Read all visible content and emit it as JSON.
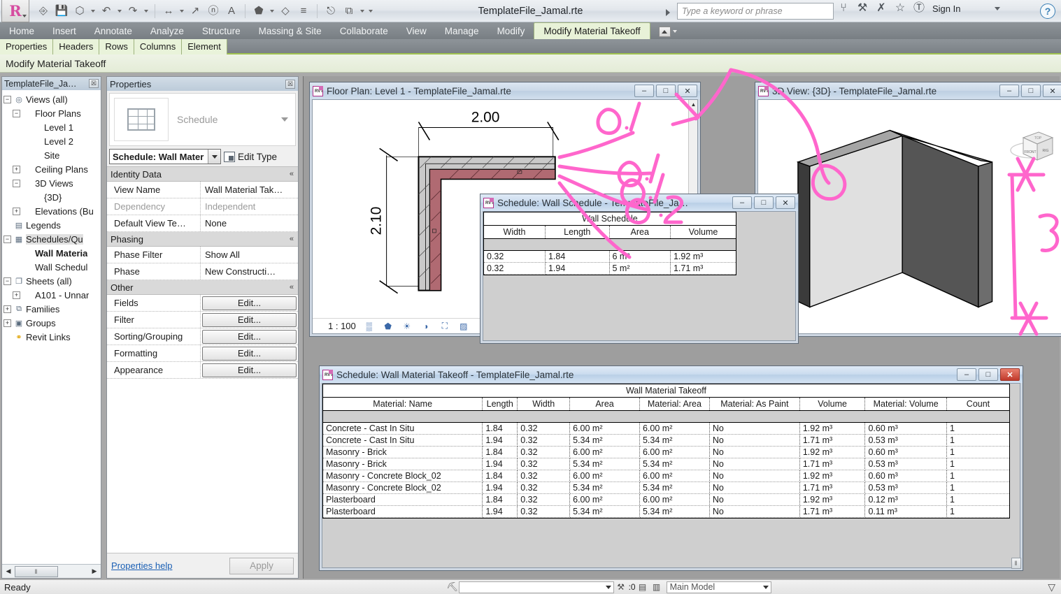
{
  "titlebar": {
    "document_title": "TemplateFile_Jamal.rte",
    "search_placeholder": "Type a keyword or phrase",
    "sign_in": "Sign In",
    "help_glyph": "?",
    "quick_access": [
      {
        "name": "open-icon",
        "glyph": "◱"
      },
      {
        "name": "save-icon",
        "glyph": "ὋE"
      },
      {
        "name": "sync-icon",
        "glyph": "⬡"
      },
      {
        "name": "undo-icon",
        "glyph": "↶"
      },
      {
        "name": "redo-icon",
        "glyph": "↷"
      },
      {
        "name": "measure-icon",
        "glyph": "↔"
      },
      {
        "name": "aligned-dimension-icon",
        "glyph": "↗"
      },
      {
        "name": "tag-icon",
        "glyph": "ⓞ"
      },
      {
        "name": "text-icon",
        "glyph": "A"
      },
      {
        "name": "default-3d-view-icon",
        "glyph": "⬟"
      },
      {
        "name": "section-icon",
        "glyph": "◇"
      },
      {
        "name": "thin-lines-icon",
        "glyph": "≡"
      },
      {
        "name": "close-hidden-windows-icon",
        "glyph": "⎋"
      },
      {
        "name": "switch-windows-icon",
        "glyph": "⧉"
      },
      {
        "name": "customize-qat-icon",
        "glyph": "▾"
      }
    ],
    "right_icons": [
      {
        "name": "infocenter-search-icon",
        "glyph": "⑂"
      },
      {
        "name": "subscription-center-icon",
        "glyph": "⚒"
      },
      {
        "name": "communication-center-icon",
        "glyph": "✇"
      },
      {
        "name": "favorites-icon",
        "glyph": "☆"
      },
      {
        "name": "user-account-icon",
        "glyph": "⛉"
      }
    ]
  },
  "ribbon": {
    "tabs": [
      {
        "label": "Home",
        "active": false
      },
      {
        "label": "Insert",
        "active": false
      },
      {
        "label": "Annotate",
        "active": false
      },
      {
        "label": "Analyze",
        "active": false
      },
      {
        "label": "Structure",
        "active": false
      },
      {
        "label": "Massing & Site",
        "active": false
      },
      {
        "label": "Collaborate",
        "active": false
      },
      {
        "label": "View",
        "active": false
      },
      {
        "label": "Manage",
        "active": false
      },
      {
        "label": "Modify",
        "active": false
      },
      {
        "label": "Modify Material Takeoff",
        "active": true
      }
    ],
    "panel_tabs": [
      "Properties",
      "Headers",
      "Rows",
      "Columns",
      "Element"
    ],
    "contextual_label": "Modify Material Takeoff"
  },
  "browser": {
    "title": "TemplateFile_Ja…",
    "close_glyph": "☒",
    "nodes": [
      {
        "label": "Views (all)",
        "indent": 0,
        "expander": "−",
        "icon": "views-icon",
        "icon_glyph": "◎",
        "bold": false,
        "selected": false
      },
      {
        "label": "Floor Plans",
        "indent": 1,
        "expander": "−",
        "icon": "folder-icon",
        "icon_glyph": "",
        "bold": false,
        "selected": false
      },
      {
        "label": "Level 1",
        "indent": 2,
        "expander": "",
        "icon": "view-icon",
        "icon_glyph": "",
        "bold": false,
        "selected": false
      },
      {
        "label": "Level 2",
        "indent": 2,
        "expander": "",
        "icon": "view-icon",
        "icon_glyph": "",
        "bold": false,
        "selected": false
      },
      {
        "label": "Site",
        "indent": 2,
        "expander": "",
        "icon": "view-icon",
        "icon_glyph": "",
        "bold": false,
        "selected": false
      },
      {
        "label": "Ceiling Plans",
        "indent": 1,
        "expander": "+",
        "icon": "folder-icon",
        "icon_glyph": "",
        "bold": false,
        "selected": false
      },
      {
        "label": "3D Views",
        "indent": 1,
        "expander": "−",
        "icon": "folder-icon",
        "icon_glyph": "",
        "bold": false,
        "selected": false
      },
      {
        "label": "{3D}",
        "indent": 2,
        "expander": "",
        "icon": "view-icon",
        "icon_glyph": "",
        "bold": false,
        "selected": false
      },
      {
        "label": "Elevations (Bu",
        "indent": 1,
        "expander": "+",
        "icon": "folder-icon",
        "icon_glyph": "",
        "bold": false,
        "selected": false
      },
      {
        "label": "Legends",
        "indent": 0,
        "expander": "",
        "icon": "legend-icon",
        "icon_glyph": "▤",
        "bold": false,
        "selected": false
      },
      {
        "label": "Schedules/Qu",
        "indent": 0,
        "expander": "−",
        "icon": "schedule-icon",
        "icon_glyph": "▦",
        "bold": false,
        "selected": true
      },
      {
        "label": "Wall Materia",
        "indent": 1,
        "expander": "",
        "icon": "schedule-view-icon",
        "icon_glyph": "",
        "bold": true,
        "selected": false
      },
      {
        "label": "Wall Schedul",
        "indent": 1,
        "expander": "",
        "icon": "schedule-view-icon",
        "icon_glyph": "",
        "bold": false,
        "selected": false
      },
      {
        "label": "Sheets (all)",
        "indent": 0,
        "expander": "−",
        "icon": "sheets-icon",
        "icon_glyph": "❐",
        "bold": false,
        "selected": false
      },
      {
        "label": "A101 - Unnar",
        "indent": 1,
        "expander": "+",
        "icon": "sheet-icon",
        "icon_glyph": "",
        "bold": false,
        "selected": false
      },
      {
        "label": "Families",
        "indent": 0,
        "expander": "+",
        "icon": "families-icon",
        "icon_glyph": "⧉",
        "bold": false,
        "selected": false
      },
      {
        "label": "Groups",
        "indent": 0,
        "expander": "+",
        "icon": "groups-icon",
        "icon_glyph": "▣",
        "bold": false,
        "selected": false
      },
      {
        "label": "Revit Links",
        "indent": 0,
        "expander": "",
        "icon": "link-icon",
        "icon_glyph": "⚭",
        "bold": false,
        "selected": false
      }
    ],
    "scroll_thumb_glyph": "‖",
    "left_arrow": "◀",
    "right_arrow": "▶"
  },
  "properties": {
    "title": "Properties",
    "close_glyph": "☒",
    "preview_label": "Schedule",
    "type_selector": "Schedule: Wall Mater",
    "edit_type_label": "Edit Type",
    "groups": [
      {
        "name": "Identity Data",
        "collapse_glyph": "«",
        "rows": [
          {
            "key": "View Name",
            "value": "Wall Material Tak…",
            "dim": false,
            "button": false
          },
          {
            "key": "Dependency",
            "value": "Independent",
            "dim": true,
            "button": false
          },
          {
            "key": "Default View Te…",
            "value": "None",
            "dim": false,
            "button": false
          }
        ]
      },
      {
        "name": "Phasing",
        "collapse_glyph": "«",
        "rows": [
          {
            "key": "Phase Filter",
            "value": "Show All",
            "dim": false,
            "button": false
          },
          {
            "key": "Phase",
            "value": "New Constructi…",
            "dim": false,
            "button": false
          }
        ]
      },
      {
        "name": "Other",
        "collapse_glyph": "«",
        "rows": [
          {
            "key": "Fields",
            "value": "Edit...",
            "dim": false,
            "button": true
          },
          {
            "key": "Filter",
            "value": "Edit...",
            "dim": false,
            "button": true
          },
          {
            "key": "Sorting/Grouping",
            "value": "Edit...",
            "dim": false,
            "button": true
          },
          {
            "key": "Formatting",
            "value": "Edit...",
            "dim": false,
            "button": true
          },
          {
            "key": "Appearance",
            "value": "Edit...",
            "dim": false,
            "button": true
          }
        ]
      }
    ],
    "help_link": "Properties help",
    "apply_label": "Apply"
  },
  "windows": {
    "floor_plan": {
      "title": "Floor Plan: Level 1 - TemplateFile_Jamal.rte",
      "minimize": "–",
      "maximize": "□",
      "close": "✕",
      "scale": "1 : 100",
      "dim_horizontal": "2.00",
      "dim_vertical": "2.10",
      "view_controls": [
        {
          "name": "detail-level-icon",
          "glyph": "▒"
        },
        {
          "name": "visual-style-icon",
          "glyph": "⬟"
        },
        {
          "name": "sun-path-icon",
          "glyph": "☀"
        },
        {
          "name": "shadows-icon",
          "glyph": "◑"
        },
        {
          "name": "crop-view-icon",
          "glyph": "⛶"
        },
        {
          "name": "reveal-hidden-icon",
          "glyph": "▨"
        }
      ]
    },
    "wall_schedule": {
      "title": "Schedule: Wall Schedule - TemplateFile_Ja…",
      "minimize": "–",
      "maximize": "□",
      "close": "✕",
      "caption": "Wall Schedule",
      "columns": [
        "Width",
        "Length",
        "Area",
        "Volume"
      ],
      "rows": [
        [
          "0.32",
          "1.84",
          "6 m²",
          "1.92 m³"
        ],
        [
          "0.32",
          "1.94",
          "5 m²",
          "1.71 m³"
        ]
      ]
    },
    "view_3d": {
      "title": "3D View: {3D} - TemplateFile_Jamal.rte",
      "minimize": "–",
      "maximize": "□",
      "close": "✕",
      "viewcube_faces": {
        "top": "TOP",
        "front": "FRONT",
        "right": "RIGHT"
      }
    },
    "material_takeoff": {
      "title": "Schedule: Wall Material Takeoff - TemplateFile_Jamal.rte",
      "minimize": "–",
      "maximize": "□",
      "close": "✕",
      "caption": "Wall Material Takeoff",
      "columns": [
        "Material: Name",
        "Length",
        "Width",
        "Area",
        "Material: Area",
        "Material: As Paint",
        "Volume",
        "Material: Volume",
        "Count"
      ],
      "rows": [
        [
          "Concrete - Cast In Situ",
          "1.84",
          "0.32",
          "6.00 m²",
          "6.00 m²",
          "No",
          "1.92 m³",
          "0.60 m³",
          "1"
        ],
        [
          "Concrete - Cast In Situ",
          "1.94",
          "0.32",
          "5.34 m²",
          "5.34 m²",
          "No",
          "1.71 m³",
          "0.53 m³",
          "1"
        ],
        [
          "Masonry - Brick",
          "1.84",
          "0.32",
          "6.00 m²",
          "6.00 m²",
          "No",
          "1.92 m³",
          "0.60 m³",
          "1"
        ],
        [
          "Masonry - Brick",
          "1.94",
          "0.32",
          "5.34 m²",
          "5.34 m²",
          "No",
          "1.71 m³",
          "0.53 m³",
          "1"
        ],
        [
          "Masonry - Concrete Block_02",
          "1.84",
          "0.32",
          "6.00 m²",
          "6.00 m²",
          "No",
          "1.92 m³",
          "0.60 m³",
          "1"
        ],
        [
          "Masonry - Concrete Block_02",
          "1.94",
          "0.32",
          "5.34 m²",
          "5.34 m²",
          "No",
          "1.71 m³",
          "0.53 m³",
          "1"
        ],
        [
          "Plasterboard",
          "1.84",
          "0.32",
          "6.00 m²",
          "6.00 m²",
          "No",
          "1.92 m³",
          "0.12 m³",
          "1"
        ],
        [
          "Plasterboard",
          "1.94",
          "0.32",
          "5.34 m²",
          "5.34 m²",
          "No",
          "1.71 m³",
          "0.11 m³",
          "1"
        ]
      ],
      "grip_glyph": "‖"
    }
  },
  "annotations": {
    "color": "#ff66cc",
    "marks": [
      "0.1",
      "0.1",
      "0.1",
      "0.2",
      "3"
    ]
  },
  "statusbar": {
    "ready": "Ready",
    "selection_count": ":0",
    "worksets": "Main Model",
    "filter_glyph": "▽",
    "icons": [
      {
        "name": "press-select-icon",
        "glyph": "⛏"
      },
      {
        "name": "selection-count-icon",
        "glyph": "⚒"
      },
      {
        "name": "design-options-icon",
        "glyph": "▤"
      },
      {
        "name": "exclude-options-icon",
        "glyph": "▥"
      }
    ]
  }
}
